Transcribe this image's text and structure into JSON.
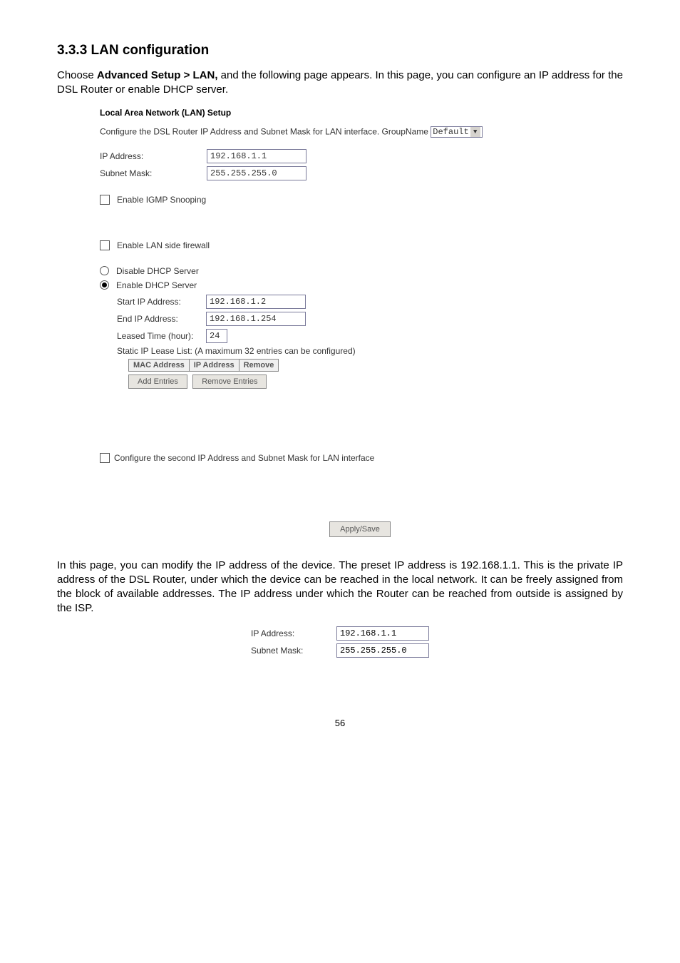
{
  "section_heading": "3.3.3 LAN configuration",
  "intro_prefix": "Choose ",
  "intro_bold": "Advanced Setup > LAN,",
  "intro_suffix": " and the following page appears. In this page, you can configure an IP address for the DSL Router or enable DHCP server.",
  "panel": {
    "title": "Local Area Network (LAN) Setup",
    "conf_line": "Configure the DSL Router IP Address and Subnet Mask for LAN interface.  GroupName",
    "group_dropdown": "Default",
    "ip_label": "IP Address:",
    "ip_value": "192.168.1.1",
    "mask_label": "Subnet Mask:",
    "mask_value": "255.255.255.0",
    "igmp_label": "Enable IGMP Snooping",
    "firewall_label": "Enable LAN side firewall",
    "disable_dhcp_label": "Disable DHCP Server",
    "enable_dhcp_label": "Enable DHCP Server",
    "start_ip_label": "Start IP Address:",
    "start_ip_value": "192.168.1.2",
    "end_ip_label": "End IP Address:",
    "end_ip_value": "192.168.1.254",
    "leased_label": "Leased Time (hour):",
    "leased_value": "24",
    "lease_note": "Static IP Lease List: (A maximum 32 entries can be configured)",
    "table_headers": [
      "MAC Address",
      "IP Address",
      "Remove"
    ],
    "add_btn": "Add Entries",
    "remove_btn": "Remove Entries",
    "second_ip_label": "Configure the second IP Address and Subnet Mask for LAN interface",
    "apply_btn": "Apply/Save"
  },
  "body_para": "In this page, you can modify the IP address of the device. The preset IP address is 192.168.1.1. This is the private IP address of the DSL Router, under which the device can be reached in the local network. It can be freely assigned from the block of available addresses. The IP address under which the Router can be reached from outside is assigned by the ISP.",
  "bottom": {
    "ip_label": "IP Address:",
    "ip_value": "192.168.1.1",
    "mask_label": "Subnet Mask:",
    "mask_value": "255.255.255.0"
  },
  "page_num": "56"
}
